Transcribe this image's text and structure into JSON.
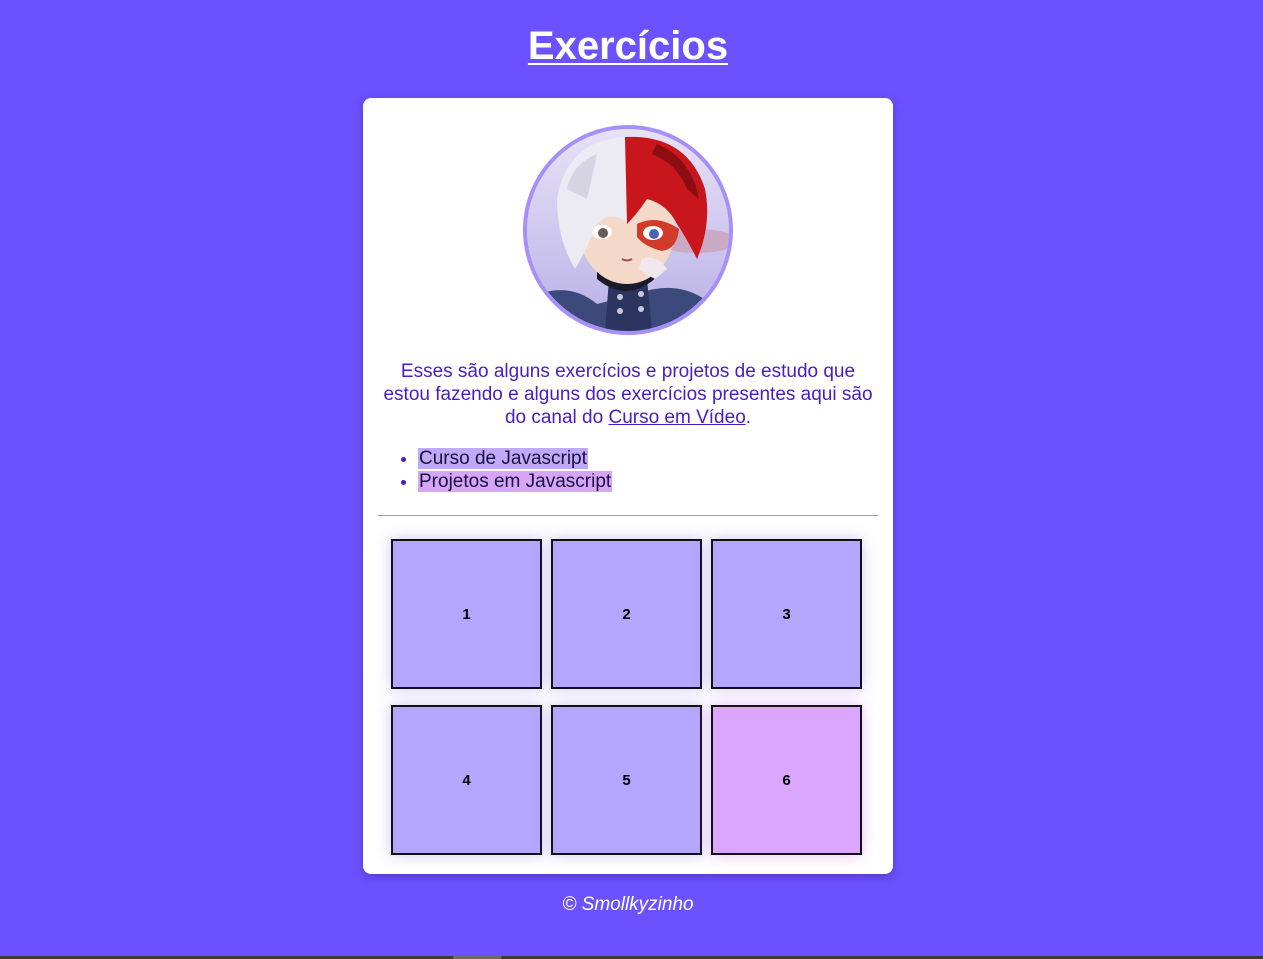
{
  "header": {
    "title": "Exercícios"
  },
  "card": {
    "avatar_alt": "avatar",
    "intro": {
      "text_before": "Esses são alguns exercícios e projetos de estudo que estou fazendo e alguns dos exercícios presentes aqui são do canal do ",
      "link_text": "Curso em Vídeo",
      "text_after": "."
    },
    "courses": [
      {
        "label": "Curso de Javascript"
      },
      {
        "label": "Projetos em Javascript"
      }
    ],
    "tiles": [
      {
        "label": "1"
      },
      {
        "label": "2"
      },
      {
        "label": "3"
      },
      {
        "label": "4"
      },
      {
        "label": "5"
      },
      {
        "label": "6"
      }
    ]
  },
  "footer": {
    "text": "© Smollkyzinho"
  },
  "colors": {
    "background": "#6c52fe",
    "card": "#ffffff",
    "text_accent": "#4a1cc4",
    "tile": "#b4a6ff",
    "tile_highlight": "#dba6fd",
    "avatar_border": "#a78ff8",
    "list_highlight_1": "#bfa9f8",
    "list_highlight_2": "#d7a5f7"
  }
}
